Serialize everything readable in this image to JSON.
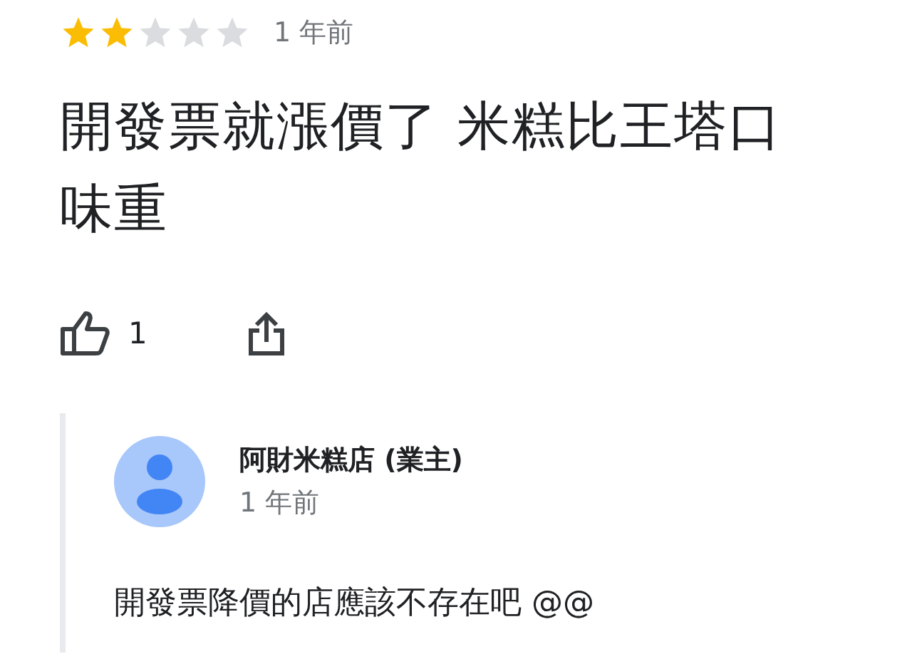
{
  "review": {
    "stars": 2,
    "time": "1 年前",
    "text": "開發票就漲價了 米糕比王塔口味重",
    "likes": "1"
  },
  "owner_reply": {
    "name": "阿財米糕店 (業主)",
    "time": "1 年前",
    "text": "開發票降價的店應該不存在吧 @@"
  }
}
